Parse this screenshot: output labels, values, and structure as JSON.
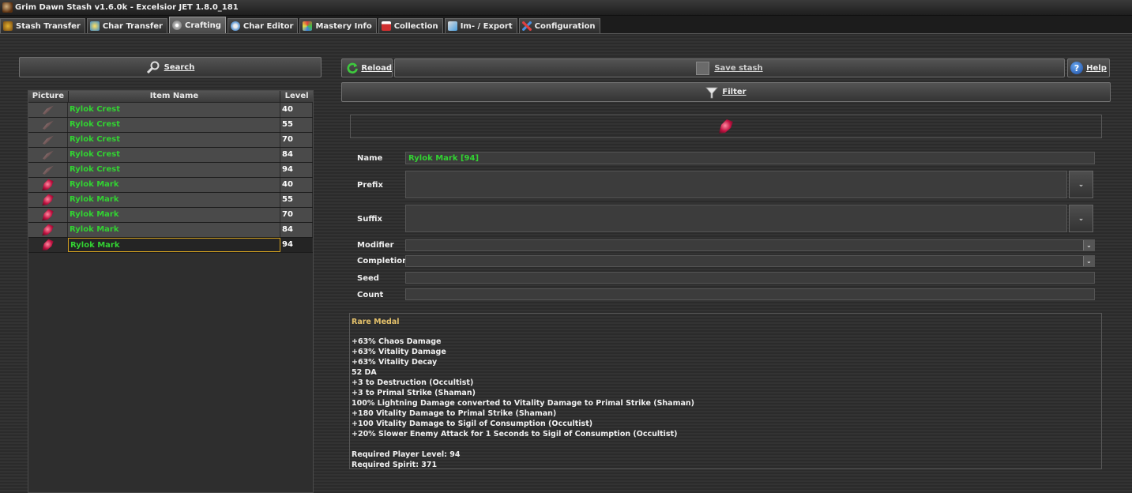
{
  "window": {
    "title": "Grim Dawn Stash v1.6.0k - Excelsior JET 1.8.0_181"
  },
  "tabs": [
    {
      "label": "Stash Transfer",
      "icon": "stash-icon",
      "active": false
    },
    {
      "label": "Char Transfer",
      "icon": "char-transfer-icon",
      "active": false
    },
    {
      "label": "Crafting",
      "icon": "gear-icon",
      "active": true
    },
    {
      "label": "Char Editor",
      "icon": "char-editor-icon",
      "active": false
    },
    {
      "label": "Mastery Info",
      "icon": "mastery-icon",
      "active": false
    },
    {
      "label": "Collection",
      "icon": "collection-icon",
      "active": false
    },
    {
      "label": "Im- / Export",
      "icon": "import-export-icon",
      "active": false
    },
    {
      "label": "Configuration",
      "icon": "tools-icon",
      "active": false
    }
  ],
  "toolbar": {
    "search_label": "Search",
    "reload_label": "Reload",
    "save_label": "Save stash",
    "help_label": "Help",
    "filter_label": "Filter"
  },
  "grid": {
    "headers": [
      "Picture",
      "Item Name",
      "Level"
    ],
    "rows": [
      {
        "name": "Rylok Crest",
        "level": "40",
        "kind": "crest"
      },
      {
        "name": "Rylok Crest",
        "level": "55",
        "kind": "crest"
      },
      {
        "name": "Rylok Crest",
        "level": "70",
        "kind": "crest"
      },
      {
        "name": "Rylok Crest",
        "level": "84",
        "kind": "crest"
      },
      {
        "name": "Rylok Crest",
        "level": "94",
        "kind": "crest"
      },
      {
        "name": "Rylok Mark",
        "level": "40",
        "kind": "mark"
      },
      {
        "name": "Rylok Mark",
        "level": "55",
        "kind": "mark"
      },
      {
        "name": "Rylok Mark",
        "level": "70",
        "kind": "mark"
      },
      {
        "name": "Rylok Mark",
        "level": "84",
        "kind": "mark"
      },
      {
        "name": "Rylok Mark",
        "level": "94",
        "kind": "mark"
      }
    ],
    "selected_index": 9
  },
  "form": {
    "name_label": "Name",
    "name_value": "Rylok Mark [94]",
    "prefix_label": "Prefix",
    "suffix_label": "Suffix",
    "modifier_label": "Modifier",
    "completion_label": "Completion",
    "seed_label": "Seed",
    "count_label": "Count",
    "seed_value": "",
    "count_value": ""
  },
  "info": {
    "rarity": "Rare Medal",
    "stats": [
      "+63% Chaos Damage",
      "+63% Vitality Damage",
      "+63% Vitality Decay",
      "52 DA",
      "+3 to Destruction (Occultist)",
      "+3 to Primal Strike (Shaman)",
      "100% Lightning Damage converted to Vitality Damage to Primal Strike (Shaman)",
      "+180 Vitality Damage to Primal Strike (Shaman)",
      "+100 Vitality Damage to Sigil of Consumption (Occultist)",
      "+20% Slower Enemy Attack for 1 Seconds to Sigil of Consumption (Occultist)"
    ],
    "requirements": [
      "Required Player Level: 94",
      "Required Spirit: 371"
    ]
  }
}
